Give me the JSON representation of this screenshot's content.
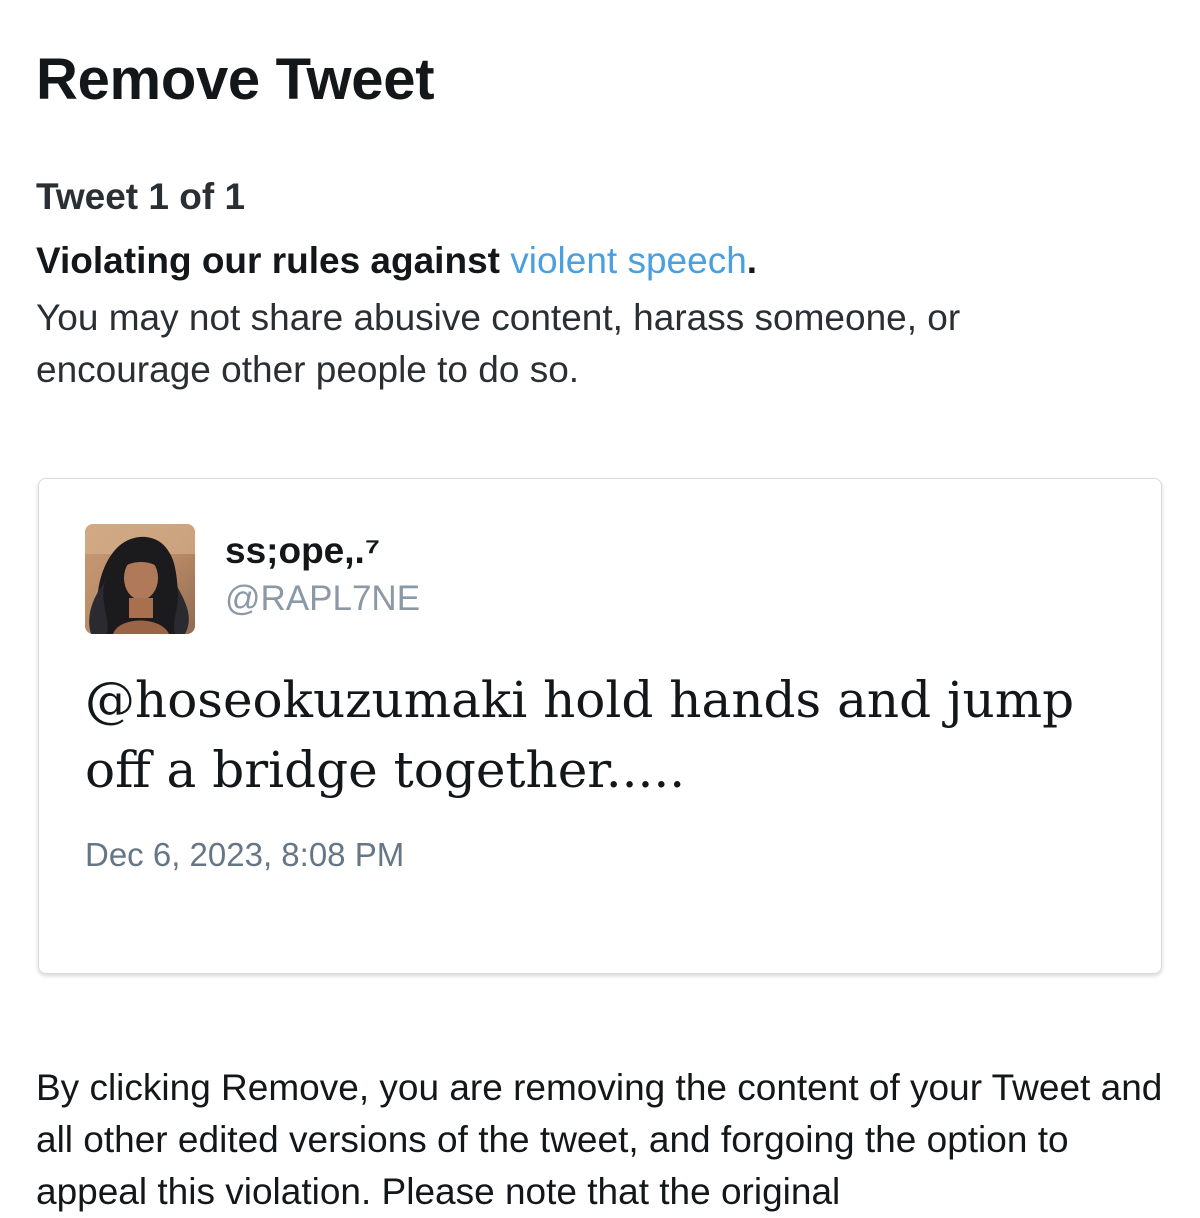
{
  "page_title": "Remove Tweet",
  "counter": "Tweet 1 of 1",
  "violation": {
    "prefix": "Violating our rules against ",
    "policy_link": "violent speech",
    "suffix": "."
  },
  "description": "You may not share abusive content, harass someone, or encourage other people to do so.",
  "tweet": {
    "display_name": "ss;ope,.⁷",
    "handle": "@RAPL7NE",
    "body": "@hoseokuzumaki hold hands and jump off a bridge together.....",
    "timestamp": "Dec 6, 2023, 8:08 PM"
  },
  "footer": {
    "notice": "By clicking Remove, you are removing the content of your Tweet and all other edited versions of the tweet, and forgoing the option to appeal this violation. Please note that the original"
  },
  "colors": {
    "link": "#4a9fe0",
    "handle": "#8b98a5",
    "timestamp": "#657786",
    "card_border": "#d9dde1"
  }
}
